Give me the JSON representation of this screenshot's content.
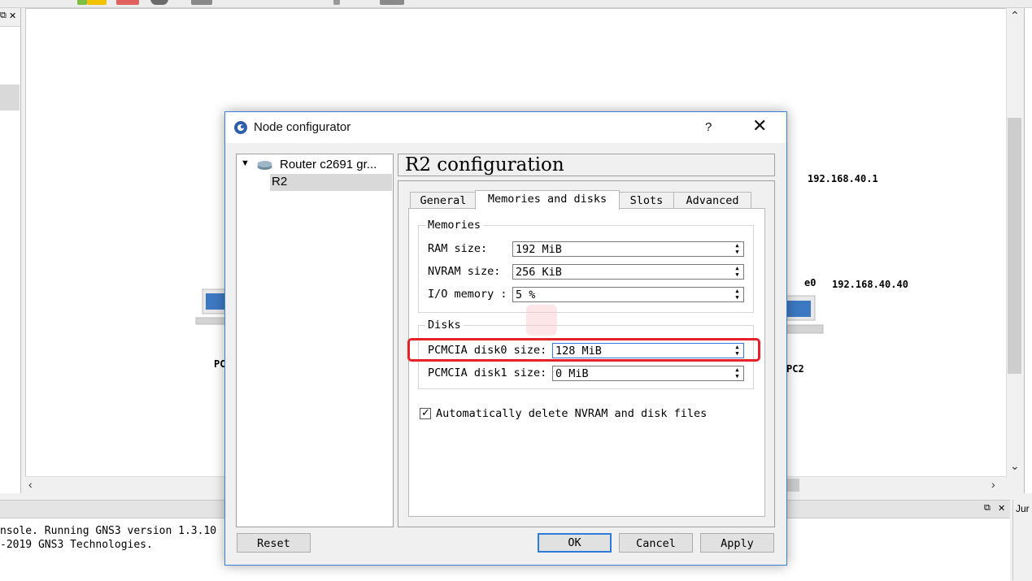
{
  "canvas": {
    "ip_labels": [
      "192.168.40.1",
      "192.168.40.40"
    ],
    "interface_label": "e0",
    "pc_left_label": "PC",
    "pc_right_label": "PC2"
  },
  "console": {
    "lines": [
      "nsole. Running GNS3 version 1.3.10",
      "-2019 GNS3 Technologies."
    ],
    "right_panel_label": "Jur"
  },
  "dialog": {
    "title": "Node configurator",
    "help_label": "?",
    "close_label": "✕",
    "tree": {
      "root": "Router c2691 gr...",
      "child": "R2"
    },
    "config_title": "R2 configuration",
    "tabs": [
      "General",
      "Memories and disks",
      "Slots",
      "Advanced"
    ],
    "active_tab": "Memories and disks",
    "memories": {
      "title": "Memories",
      "ram_label": "RAM size:",
      "ram_value": "192 MiB",
      "nvram_label": "NVRAM size:",
      "nvram_value": "256 KiB",
      "io_label": "I/O memory :",
      "io_value": "5 %"
    },
    "disks": {
      "title": "Disks",
      "disk0_label": "PCMCIA disk0 size:",
      "disk0_value": "128 MiB",
      "disk1_label": "PCMCIA disk1 size:",
      "disk1_value": "0 MiB"
    },
    "auto_delete_label": "Automatically delete NVRAM and disk files",
    "auto_delete_checked": true,
    "buttons": {
      "reset": "Reset",
      "ok": "OK",
      "cancel": "Cancel",
      "apply": "Apply"
    }
  },
  "colors": {
    "highlight": "#e5222a",
    "focus": "#2f7bd9"
  }
}
